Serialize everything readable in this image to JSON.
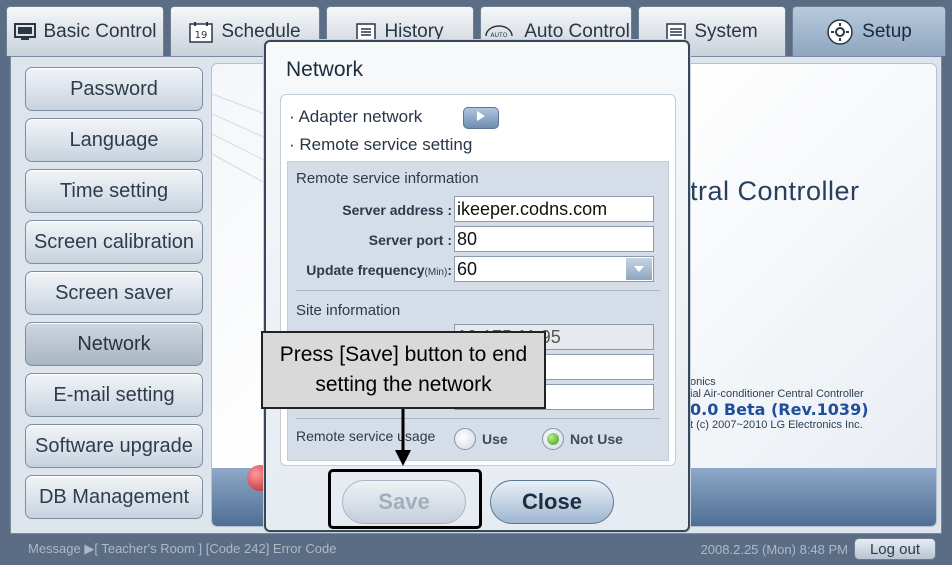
{
  "tabs": [
    {
      "label": "Basic Control",
      "icon": "monitor-icon"
    },
    {
      "label": "Schedule",
      "icon": "calendar-icon",
      "icon_text": "19"
    },
    {
      "label": "History",
      "icon": "list-icon"
    },
    {
      "label": "Auto Control",
      "icon": "auto-icon",
      "icon_text": "AUTO"
    },
    {
      "label": "System",
      "icon": "system-list-icon"
    },
    {
      "label": "Setup",
      "icon": "gear-icon",
      "active": true
    }
  ],
  "sidebar": {
    "items": [
      {
        "label": "Password"
      },
      {
        "label": "Language"
      },
      {
        "label": "Time setting"
      },
      {
        "label": "Screen calibration"
      },
      {
        "label": "Screen saver"
      },
      {
        "label": "Network",
        "active": true
      },
      {
        "label": "E-mail setting"
      },
      {
        "label": "Software upgrade"
      },
      {
        "label": "DB Management"
      }
    ]
  },
  "background": {
    "title_fragment": "tral Controller",
    "info_line1": "onics",
    "info_line2": "ial Air-conditioner Central Controller",
    "info_line3": "0.0 Beta (Rev.1039)",
    "info_line4": "t (c) 2007~2010 LG Electronics Inc."
  },
  "dialog": {
    "title": "Network",
    "adapter_label": "· Adapter network",
    "remote_label": "· Remote service setting",
    "remote_info_heading": "Remote service information",
    "server_address_label": "Server address :",
    "server_address_value": "ikeeper.codns.com",
    "server_port_label": "Server port :",
    "server_port_value": "80",
    "update_freq_label": "Update frequency",
    "update_freq_unit": "(Min)",
    "update_freq_colon": ":",
    "update_freq_value": "60",
    "site_info_heading": "Site information",
    "site_address_value": "10.175.11.95",
    "usage_label": "Remote service usage",
    "use_label": "Use",
    "not_use_label": "Not Use",
    "usage_selected": "Not Use",
    "save_label": "Save",
    "close_label": "Close"
  },
  "callout": {
    "line1": "Press [Save] button to end",
    "line2": "setting the network"
  },
  "statusbar": {
    "message": "Message ▶[ Teacher's Room ] [Code 242] Error Code",
    "datetime": "2008.2.25 (Mon)  8:48 PM",
    "logout_label": "Log out"
  },
  "colors": {
    "frame": "#5a6d84",
    "active_tab": "#a3b8cf",
    "title_blue": "#27405e"
  }
}
